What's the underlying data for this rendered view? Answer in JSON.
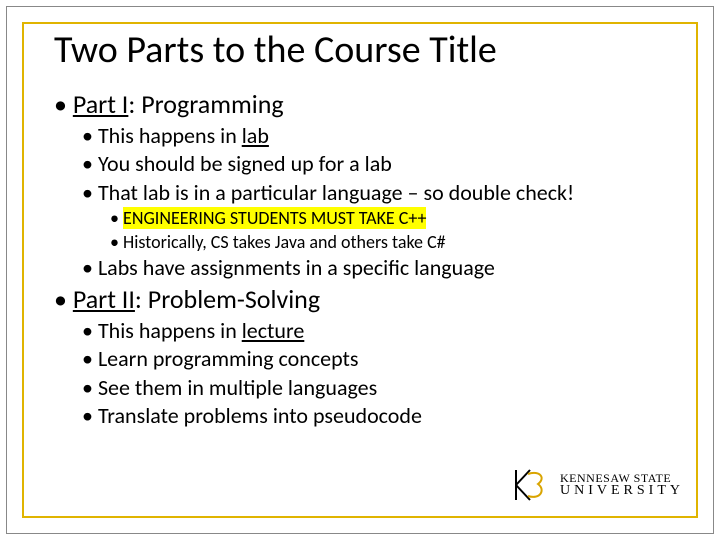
{
  "title": "Two Parts to the Course Title",
  "part1": {
    "heading_prefix": "Part I",
    "heading_rest": ": Programming",
    "b1a": "This happens in ",
    "b1a_u": "lab",
    "b2": "You should be signed up for a lab",
    "b3": "That lab is in a particular language – so double check!",
    "b3a": "ENGINEERING STUDENTS MUST TAKE C++",
    "b3b": "Historically, CS takes Java and others take C#",
    "b4": "Labs have assignments in a specific language"
  },
  "part2": {
    "heading_prefix": "Part II",
    "heading_rest": ": Problem-Solving",
    "b1a": "This happens in ",
    "b1a_u": "lecture",
    "b2": "Learn programming concepts",
    "b3": "See them in multiple languages",
    "b4": "Translate problems into pseudocode"
  },
  "logo": {
    "line1": "KENNESAW STATE",
    "line2": "UNIVERSITY"
  }
}
